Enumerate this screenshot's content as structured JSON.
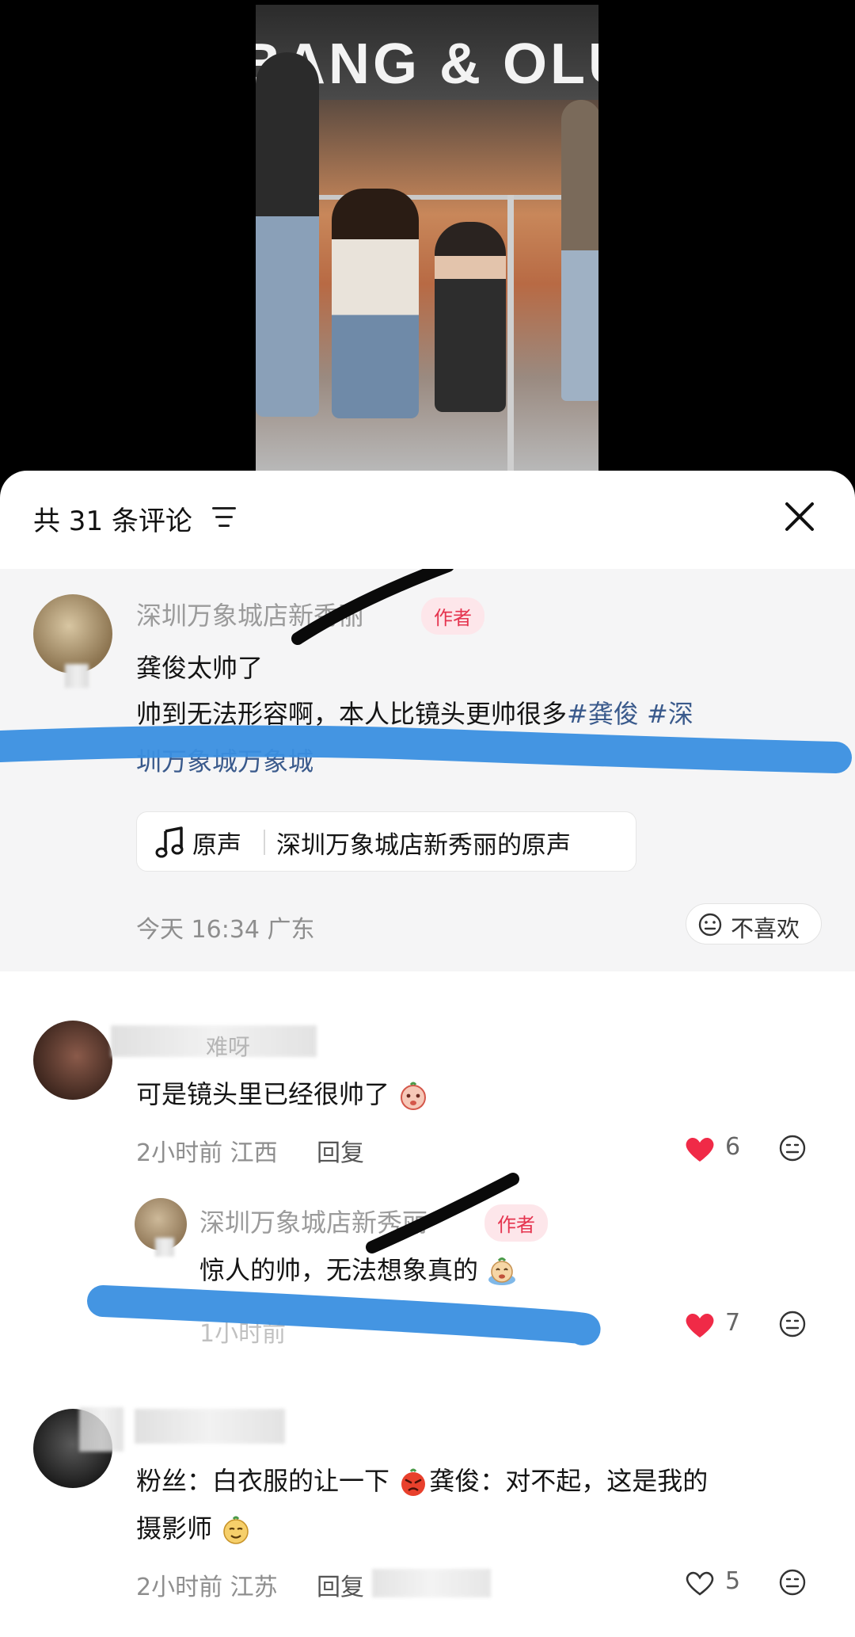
{
  "video": {
    "store_sign": "BANG & OLUFSEN"
  },
  "header": {
    "comment_count": "共 31 条评论"
  },
  "author_post": {
    "username": "深圳万象城店新秀丽",
    "author_tag": "作者",
    "line1": "龚俊太帅了",
    "line2_plain": "帅到无法形容啊，本人比镜头更帅很多",
    "hashtag1": "#龚俊",
    "hashtag2": "#深",
    "line3_hidden": "圳万象城万象城",
    "audio_prefix": "原声",
    "audio_title": "深圳万象城店新秀丽的原声",
    "timestamp": "今天 16:34 广东",
    "dislike_label": "不喜欢"
  },
  "comments": [
    {
      "username": "难呀",
      "text": "可是镜头里已经很帅了",
      "meta": "2小时前 江西",
      "reply_label": "回复",
      "likes": "6",
      "liked": true
    },
    {
      "username": "深圳万象城店新秀丽",
      "author_tag": "作者",
      "text": "惊人的帅，无法想象真的",
      "meta": "1小时前",
      "likes": "7",
      "liked": true
    },
    {
      "username": "",
      "text_line1a": "粉丝：白衣服的让一下",
      "text_line1b": "龚俊：对不起，这是我的",
      "text_line2": "摄影师",
      "meta": "2小时前 江苏",
      "reply_label": "回复",
      "likes": "5",
      "liked": false
    }
  ],
  "colors": {
    "like_red": "#f02a47",
    "author_tag_text": "#e5344f",
    "author_tag_bg": "#fde6ea",
    "hashtag": "#3a5a8c",
    "highlight_blue": "#3a8fe0"
  }
}
